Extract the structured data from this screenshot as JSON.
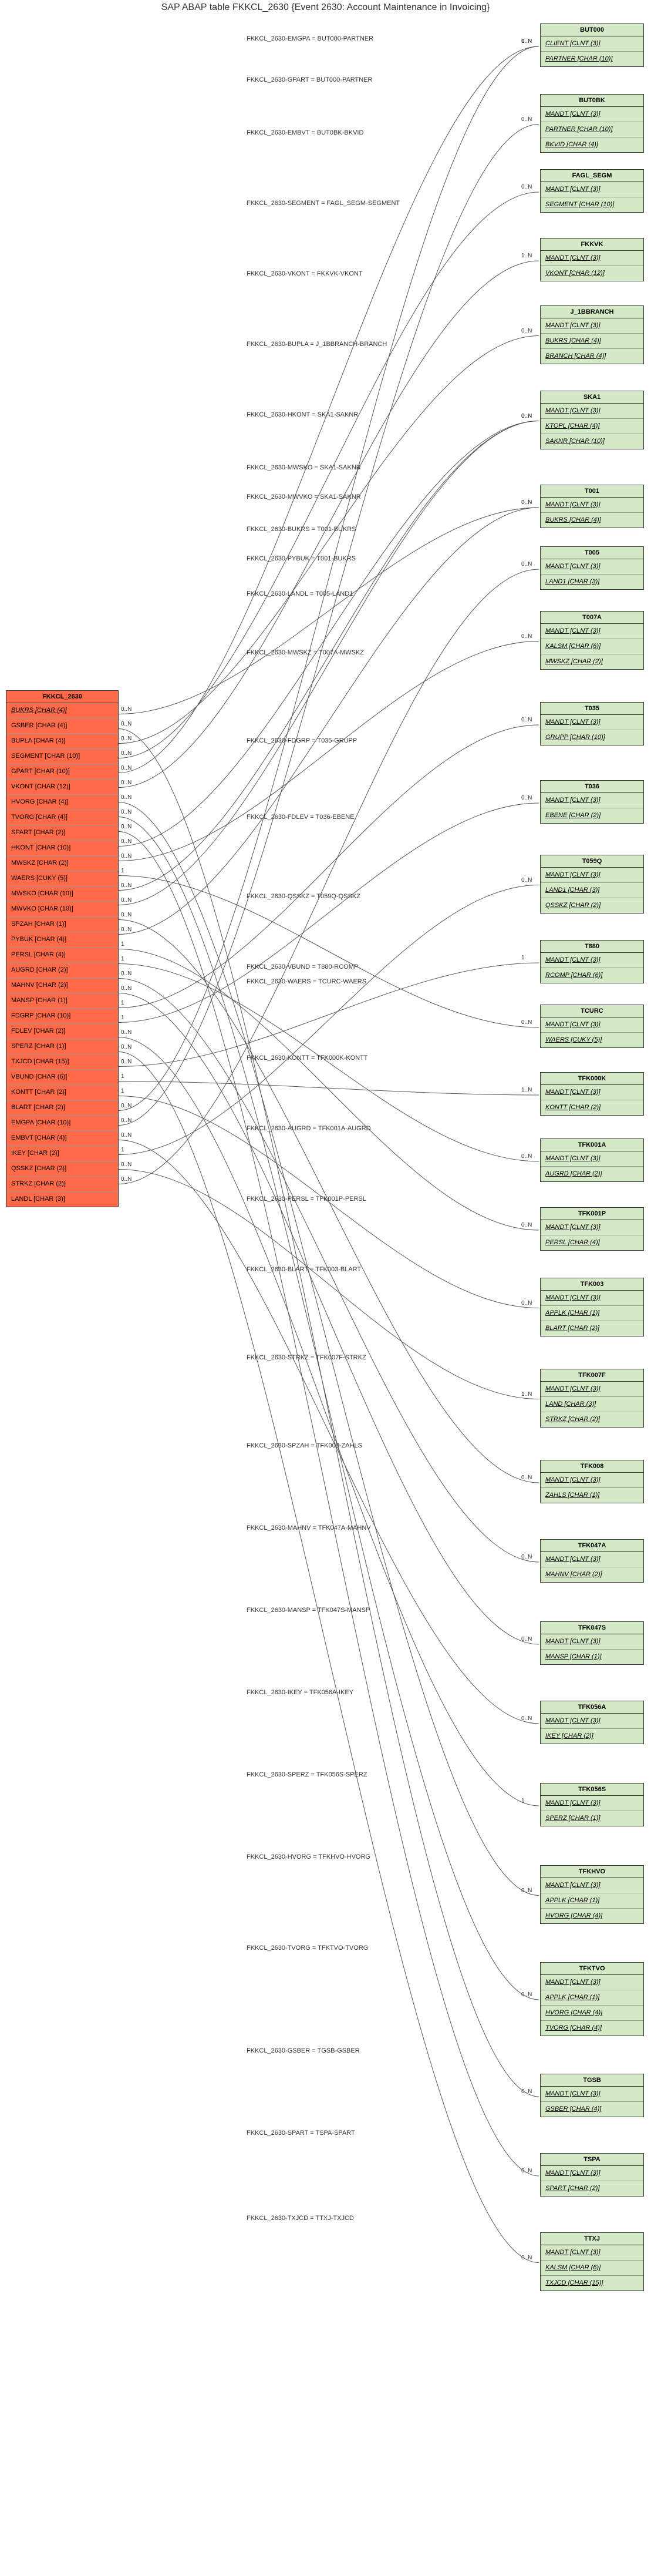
{
  "title": "SAP ABAP table FKKCL_2630 {Event 2630: Account Maintenance in Invoicing}",
  "main": {
    "name": "FKKCL_2630",
    "fields": [
      {
        "key": true,
        "label": "BUKRS [CHAR (4)]"
      },
      {
        "key": false,
        "label": "GSBER [CHAR (4)]"
      },
      {
        "key": false,
        "label": "BUPLA [CHAR (4)]"
      },
      {
        "key": false,
        "label": "SEGMENT [CHAR (10)]"
      },
      {
        "key": false,
        "label": "GPART [CHAR (10)]"
      },
      {
        "key": false,
        "label": "VKONT [CHAR (12)]"
      },
      {
        "key": false,
        "label": "HVORG [CHAR (4)]"
      },
      {
        "key": false,
        "label": "TVORG [CHAR (4)]"
      },
      {
        "key": false,
        "label": "SPART [CHAR (2)]"
      },
      {
        "key": false,
        "label": "HKONT [CHAR (10)]"
      },
      {
        "key": false,
        "label": "MWSKZ [CHAR (2)]"
      },
      {
        "key": false,
        "label": "WAERS [CUKY (5)]"
      },
      {
        "key": false,
        "label": "MWSKO [CHAR (10)]"
      },
      {
        "key": false,
        "label": "MWVKO [CHAR (10)]"
      },
      {
        "key": false,
        "label": "SPZAH [CHAR (1)]"
      },
      {
        "key": false,
        "label": "PYBUK [CHAR (4)]"
      },
      {
        "key": false,
        "label": "PERSL [CHAR (4)]"
      },
      {
        "key": false,
        "label": "AUGRD [CHAR (2)]"
      },
      {
        "key": false,
        "label": "MAHNV [CHAR (2)]"
      },
      {
        "key": false,
        "label": "MANSP [CHAR (1)]"
      },
      {
        "key": false,
        "label": "FDGRP [CHAR (10)]"
      },
      {
        "key": false,
        "label": "FDLEV [CHAR (2)]"
      },
      {
        "key": false,
        "label": "SPERZ [CHAR (1)]"
      },
      {
        "key": false,
        "label": "TXJCD [CHAR (15)]"
      },
      {
        "key": false,
        "label": "VBUND [CHAR (6)]"
      },
      {
        "key": false,
        "label": "KONTT [CHAR (2)]"
      },
      {
        "key": false,
        "label": "BLART [CHAR (2)]"
      },
      {
        "key": false,
        "label": "EMGPA [CHAR (10)]"
      },
      {
        "key": false,
        "label": "EMBVT [CHAR (4)]"
      },
      {
        "key": false,
        "label": "IKEY [CHAR (2)]"
      },
      {
        "key": false,
        "label": "QSSKZ [CHAR (2)]"
      },
      {
        "key": false,
        "label": "STRKZ [CHAR (2)]"
      },
      {
        "key": false,
        "label": "LANDL [CHAR (3)]"
      }
    ]
  },
  "targets": [
    {
      "id": "BUT000",
      "name": "BUT000",
      "fields": [
        {
          "key": true,
          "label": "CLIENT [CLNT (3)]"
        },
        {
          "key": true,
          "label": "PARTNER [CHAR (10)]"
        }
      ]
    },
    {
      "id": "BUT0BK",
      "name": "BUT0BK",
      "fields": [
        {
          "key": true,
          "label": "MANDT [CLNT (3)]"
        },
        {
          "key": true,
          "label": "PARTNER [CHAR (10)]"
        },
        {
          "key": true,
          "label": "BKVID [CHAR (4)]"
        }
      ]
    },
    {
      "id": "FAGL_SEGM",
      "name": "FAGL_SEGM",
      "fields": [
        {
          "key": true,
          "label": "MANDT [CLNT (3)]"
        },
        {
          "key": true,
          "label": "SEGMENT [CHAR (10)]"
        }
      ]
    },
    {
      "id": "FKKVK",
      "name": "FKKVK",
      "fields": [
        {
          "key": true,
          "label": "MANDT [CLNT (3)]"
        },
        {
          "key": true,
          "label": "VKONT [CHAR (12)]"
        }
      ]
    },
    {
      "id": "J_1BBRANCH",
      "name": "J_1BBRANCH",
      "fields": [
        {
          "key": true,
          "label": "MANDT [CLNT (3)]"
        },
        {
          "key": true,
          "label": "BUKRS [CHAR (4)]"
        },
        {
          "key": true,
          "label": "BRANCH [CHAR (4)]"
        }
      ]
    },
    {
      "id": "SKA1",
      "name": "SKA1",
      "fields": [
        {
          "key": true,
          "label": "MANDT [CLNT (3)]"
        },
        {
          "key": true,
          "label": "KTOPL [CHAR (4)]"
        },
        {
          "key": true,
          "label": "SAKNR [CHAR (10)]"
        }
      ]
    },
    {
      "id": "T001",
      "name": "T001",
      "fields": [
        {
          "key": true,
          "label": "MANDT [CLNT (3)]"
        },
        {
          "key": true,
          "label": "BUKRS [CHAR (4)]"
        }
      ]
    },
    {
      "id": "T005",
      "name": "T005",
      "fields": [
        {
          "key": true,
          "label": "MANDT [CLNT (3)]"
        },
        {
          "key": true,
          "label": "LAND1 [CHAR (3)]"
        }
      ]
    },
    {
      "id": "T007A",
      "name": "T007A",
      "fields": [
        {
          "key": true,
          "label": "MANDT [CLNT (3)]"
        },
        {
          "key": true,
          "label": "KALSM [CHAR (6)]"
        },
        {
          "key": true,
          "label": "MWSKZ [CHAR (2)]"
        }
      ]
    },
    {
      "id": "T035",
      "name": "T035",
      "fields": [
        {
          "key": true,
          "label": "MANDT [CLNT (3)]"
        },
        {
          "key": true,
          "label": "GRUPP [CHAR (10)]"
        }
      ]
    },
    {
      "id": "T036",
      "name": "T036",
      "fields": [
        {
          "key": true,
          "label": "MANDT [CLNT (3)]"
        },
        {
          "key": true,
          "label": "EBENE [CHAR (2)]"
        }
      ]
    },
    {
      "id": "T059Q",
      "name": "T059Q",
      "fields": [
        {
          "key": true,
          "label": "MANDT [CLNT (3)]"
        },
        {
          "key": true,
          "label": "LAND1 [CHAR (3)]"
        },
        {
          "key": true,
          "label": "QSSKZ [CHAR (2)]"
        }
      ]
    },
    {
      "id": "T880",
      "name": "T880",
      "fields": [
        {
          "key": true,
          "label": "MANDT [CLNT (3)]"
        },
        {
          "key": true,
          "label": "RCOMP [CHAR (6)]"
        }
      ]
    },
    {
      "id": "TCURC",
      "name": "TCURC",
      "fields": [
        {
          "key": true,
          "label": "MANDT [CLNT (3)]"
        },
        {
          "key": true,
          "label": "WAERS [CUKY (5)]"
        }
      ]
    },
    {
      "id": "TFK000K",
      "name": "TFK000K",
      "fields": [
        {
          "key": true,
          "label": "MANDT [CLNT (3)]"
        },
        {
          "key": true,
          "label": "KONTT [CHAR (2)]"
        }
      ]
    },
    {
      "id": "TFK001A",
      "name": "TFK001A",
      "fields": [
        {
          "key": true,
          "label": "MANDT [CLNT (3)]"
        },
        {
          "key": true,
          "label": "AUGRD [CHAR (2)]"
        }
      ]
    },
    {
      "id": "TFK001P",
      "name": "TFK001P",
      "fields": [
        {
          "key": true,
          "label": "MANDT [CLNT (3)]"
        },
        {
          "key": true,
          "label": "PERSL [CHAR (4)]"
        }
      ]
    },
    {
      "id": "TFK003",
      "name": "TFK003",
      "fields": [
        {
          "key": true,
          "label": "MANDT [CLNT (3)]"
        },
        {
          "key": true,
          "label": "APPLK [CHAR (1)]"
        },
        {
          "key": true,
          "label": "BLART [CHAR (2)]"
        }
      ]
    },
    {
      "id": "TFK007F",
      "name": "TFK007F",
      "fields": [
        {
          "key": true,
          "label": "MANDT [CLNT (3)]"
        },
        {
          "key": true,
          "label": "LAND [CHAR (3)]"
        },
        {
          "key": true,
          "label": "STRKZ [CHAR (2)]"
        }
      ]
    },
    {
      "id": "TFK008",
      "name": "TFK008",
      "fields": [
        {
          "key": true,
          "label": "MANDT [CLNT (3)]"
        },
        {
          "key": true,
          "label": "ZAHLS [CHAR (1)]"
        }
      ]
    },
    {
      "id": "TFK047A",
      "name": "TFK047A",
      "fields": [
        {
          "key": true,
          "label": "MANDT [CLNT (3)]"
        },
        {
          "key": true,
          "label": "MAHNV [CHAR (2)]"
        }
      ]
    },
    {
      "id": "TFK047S",
      "name": "TFK047S",
      "fields": [
        {
          "key": true,
          "label": "MANDT [CLNT (3)]"
        },
        {
          "key": true,
          "label": "MANSP [CHAR (1)]"
        }
      ]
    },
    {
      "id": "TFK056A",
      "name": "TFK056A",
      "fields": [
        {
          "key": true,
          "label": "MANDT [CLNT (3)]"
        },
        {
          "key": true,
          "label": "IKEY [CHAR (2)]"
        }
      ]
    },
    {
      "id": "TFK056S",
      "name": "TFK056S",
      "fields": [
        {
          "key": true,
          "label": "MANDT [CLNT (3)]"
        },
        {
          "key": true,
          "label": "SPERZ [CHAR (1)]"
        }
      ]
    },
    {
      "id": "TFKHVO",
      "name": "TFKHVO",
      "fields": [
        {
          "key": true,
          "label": "MANDT [CLNT (3)]"
        },
        {
          "key": true,
          "label": "APPLK [CHAR (1)]"
        },
        {
          "key": true,
          "label": "HVORG [CHAR (4)]"
        }
      ]
    },
    {
      "id": "TFKTVO",
      "name": "TFKTVO",
      "fields": [
        {
          "key": true,
          "label": "MANDT [CLNT (3)]"
        },
        {
          "key": true,
          "label": "APPLK [CHAR (1)]"
        },
        {
          "key": true,
          "label": "HVORG [CHAR (4)]"
        },
        {
          "key": true,
          "label": "TVORG [CHAR (4)]"
        }
      ]
    },
    {
      "id": "TGSB",
      "name": "TGSB",
      "fields": [
        {
          "key": true,
          "label": "MANDT [CLNT (3)]"
        },
        {
          "key": true,
          "label": "GSBER [CHAR (4)]"
        }
      ]
    },
    {
      "id": "TSPA",
      "name": "TSPA",
      "fields": [
        {
          "key": true,
          "label": "MANDT [CLNT (3)]"
        },
        {
          "key": true,
          "label": "SPART [CHAR (2)]"
        }
      ]
    },
    {
      "id": "TTXJ",
      "name": "TTXJ",
      "fields": [
        {
          "key": true,
          "label": "MANDT [CLNT (3)]"
        },
        {
          "key": true,
          "label": "KALSM [CHAR (6)]"
        },
        {
          "key": true,
          "label": "TXJCD [CHAR (15)]"
        }
      ]
    }
  ],
  "edges": [
    {
      "from": "EMGPA",
      "to": "BUT000",
      "label": "FKKCL_2630-EMGPA = BUT000-PARTNER",
      "leftCard": "0..N",
      "rightCard": "0..N",
      "labelY": 60
    },
    {
      "from": "GPART",
      "to": "BUT000",
      "label": "FKKCL_2630-GPART = BUT000-PARTNER",
      "leftCard": "0..N",
      "rightCard": "1..N",
      "labelY": 130
    },
    {
      "from": "EMBVT",
      "to": "BUT0BK",
      "label": "FKKCL_2630-EMBVT = BUT0BK-BKVID",
      "leftCard": "0..N",
      "rightCard": "0..N",
      "labelY": 220
    },
    {
      "from": "SEGMENT",
      "to": "FAGL_SEGM",
      "label": "FKKCL_2630-SEGMENT = FAGL_SEGM-SEGMENT",
      "leftCard": "0..N",
      "rightCard": "0..N",
      "labelY": 340
    },
    {
      "from": "VKONT",
      "to": "FKKVK",
      "label": "FKKCL_2630-VKONT = FKKVK-VKONT",
      "leftCard": "0..N",
      "rightCard": "1..N",
      "labelY": 460
    },
    {
      "from": "BUPLA",
      "to": "J_1BBRANCH",
      "label": "FKKCL_2630-BUPLA = J_1BBRANCH-BRANCH",
      "leftCard": "0..N",
      "rightCard": "0..N",
      "labelY": 580
    },
    {
      "from": "HKONT",
      "to": "SKA1",
      "label": "FKKCL_2630-HKONT = SKA1-SAKNR",
      "leftCard": "0..N",
      "rightCard": "0..N",
      "labelY": 700
    },
    {
      "from": "MWSKO",
      "to": "SKA1",
      "label": "FKKCL_2630-MWSKO = SKA1-SAKNR",
      "leftCard": "0..N",
      "rightCard": "0..N",
      "labelY": 790
    },
    {
      "from": "MWVKO",
      "to": "SKA1",
      "label": "FKKCL_2630-MWVKO = SKA1-SAKNR",
      "leftCard": "0..N",
      "rightCard": "0..N",
      "labelY": 840
    },
    {
      "from": "BUKRS",
      "to": "T001",
      "label": "FKKCL_2630-BUKRS = T001-BUKRS",
      "leftCard": "0..N",
      "rightCard": "0..N",
      "labelY": 895
    },
    {
      "from": "PYBUK",
      "to": "T001",
      "label": "FKKCL_2630-PYBUK = T001-BUKRS",
      "leftCard": "0..N",
      "rightCard": "0..N",
      "labelY": 945
    },
    {
      "from": "LANDL",
      "to": "T005",
      "label": "FKKCL_2630-LANDL = T005-LAND1",
      "leftCard": "0..N",
      "rightCard": "0..N",
      "labelY": 1005
    },
    {
      "from": "MWSKZ",
      "to": "T007A",
      "label": "FKKCL_2630-MWSKZ = T007A-MWSKZ",
      "leftCard": "0..N",
      "rightCard": "0..N",
      "labelY": 1105
    },
    {
      "from": "FDGRP",
      "to": "T035",
      "label": "FKKCL_2630-FDGRP = T035-GRUPP",
      "leftCard": "1",
      "rightCard": "0..N",
      "labelY": 1255
    },
    {
      "from": "FDLEV",
      "to": "T036",
      "label": "FKKCL_2630-FDLEV = T036-EBENE",
      "leftCard": "1",
      "rightCard": "0..N",
      "labelY": 1385
    },
    {
      "from": "QSSKZ",
      "to": "T059Q",
      "label": "FKKCL_2630-QSSKZ = T059Q-QSSKZ",
      "leftCard": "1",
      "rightCard": "0..N",
      "labelY": 1520
    },
    {
      "from": "VBUND",
      "to": "T880",
      "label": "FKKCL_2630-VBUND = T880-RCOMP",
      "leftCard": "0..N",
      "rightCard": "1",
      "labelY": 1640
    },
    {
      "from": "WAERS",
      "to": "TCURC",
      "label": "FKKCL_2630-WAERS = TCURC-WAERS",
      "leftCard": "1",
      "rightCard": "0..N",
      "labelY": 1665
    },
    {
      "from": "KONTT",
      "to": "TFK000K",
      "label": "FKKCL_2630-KONTT = TFK000K-KONTT",
      "leftCard": "1",
      "rightCard": "1..N",
      "labelY": 1795
    },
    {
      "from": "AUGRD",
      "to": "TFK001A",
      "label": "FKKCL_2630-AUGRD = TFK001A-AUGRD",
      "leftCard": "1",
      "rightCard": "0..N",
      "labelY": 1915
    },
    {
      "from": "PERSL",
      "to": "TFK001P",
      "label": "FKKCL_2630-PERSL = TFK001P-PERSL",
      "leftCard": "1",
      "rightCard": "0..N",
      "labelY": 2035
    },
    {
      "from": "BLART",
      "to": "TFK003",
      "label": "FKKCL_2630-BLART = TFK003-BLART",
      "leftCard": "1",
      "rightCard": "0..N",
      "labelY": 2155
    },
    {
      "from": "STRKZ",
      "to": "TFK007F",
      "label": "FKKCL_2630-STRKZ = TFK007F-STRKZ",
      "leftCard": "0..N",
      "rightCard": "1..N",
      "labelY": 2305
    },
    {
      "from": "SPZAH",
      "to": "TFK008",
      "label": "FKKCL_2630-SPZAH = TFK008-ZAHLS",
      "leftCard": "0..N",
      "rightCard": "0..N",
      "labelY": 2455
    },
    {
      "from": "MAHNV",
      "to": "TFK047A",
      "label": "FKKCL_2630-MAHNV = TFK047A-MAHNV",
      "leftCard": "0..N",
      "rightCard": "0..N",
      "labelY": 2595
    },
    {
      "from": "MANSP",
      "to": "TFK047S",
      "label": "FKKCL_2630-MANSP = TFK047S-MANSP",
      "leftCard": "0..N",
      "rightCard": "0..N",
      "labelY": 2735
    },
    {
      "from": "IKEY",
      "to": "TFK056A",
      "label": "FKKCL_2630-IKEY = TFK056A-IKEY",
      "leftCard": "0..N",
      "rightCard": "0..N",
      "labelY": 2875
    },
    {
      "from": "SPERZ",
      "to": "TFK056S",
      "label": "FKKCL_2630-SPERZ = TFK056S-SPERZ",
      "leftCard": "0..N",
      "rightCard": "1",
      "labelY": 3015
    },
    {
      "from": "HVORG",
      "to": "TFKHVO",
      "label": "FKKCL_2630-HVORG = TFKHVO-HVORG",
      "leftCard": "0..N",
      "rightCard": "0..N",
      "labelY": 3155
    },
    {
      "from": "TVORG",
      "to": "TFKTVO",
      "label": "FKKCL_2630-TVORG = TFKTVO-TVORG",
      "leftCard": "0..N",
      "rightCard": "0..N",
      "labelY": 3310
    },
    {
      "from": "GSBER",
      "to": "TGSB",
      "label": "FKKCL_2630-GSBER = TGSB-GSBER",
      "leftCard": "0..N",
      "rightCard": "0..N",
      "labelY": 3485
    },
    {
      "from": "SPART",
      "to": "TSPA",
      "label": "FKKCL_2630-SPART = TSPA-SPART",
      "leftCard": "0..N",
      "rightCard": "0..N",
      "labelY": 3625
    },
    {
      "from": "TXJCD",
      "to": "TTXJ",
      "label": "FKKCL_2630-TXJCD = TTXJ-TXJCD",
      "leftCard": "0..N",
      "rightCard": "0..N",
      "labelY": 3770
    }
  ],
  "layout": {
    "mainTop": 1175,
    "mainLeft": 10,
    "mainWidth": 190,
    "rightLeft": 920,
    "rightWidth": 175,
    "fieldHeight": 25,
    "headerHeight": 28
  },
  "targetTops": {
    "BUT000": 40,
    "BUT0BK": 160,
    "FAGL_SEGM": 288,
    "FKKVK": 405,
    "J_1BBRANCH": 520,
    "SKA1": 665,
    "T001": 825,
    "T005": 930,
    "T007A": 1040,
    "T035": 1195,
    "T036": 1328,
    "T059Q": 1455,
    "T880": 1600,
    "TCURC": 1710,
    "TFK000K": 1825,
    "TFK001A": 1938,
    "TFK001P": 2055,
    "TFK003": 2175,
    "TFK007F": 2330,
    "TFK008": 2485,
    "TFK047A": 2620,
    "TFK047S": 2760,
    "TFK056A": 2895,
    "TFK056S": 3035,
    "TFKHVO": 3175,
    "TFKTVO": 3340,
    "TGSB": 3530,
    "TSPA": 3665,
    "TTXJ": 3800
  }
}
